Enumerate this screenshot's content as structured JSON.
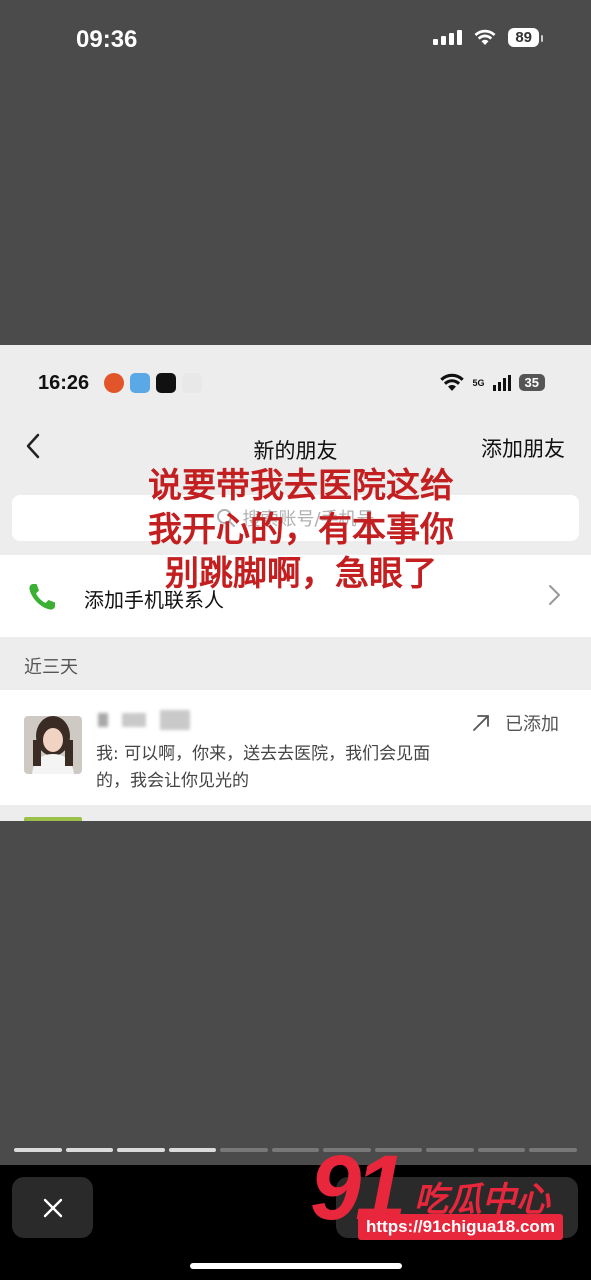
{
  "outer_status": {
    "time": "09:36",
    "battery": "89"
  },
  "inner_status": {
    "time": "16:26",
    "network": "5G",
    "battery": "35"
  },
  "nav": {
    "title": "新的朋友",
    "add_label": "添加朋友"
  },
  "search": {
    "placeholder": "搜索账号/手机号"
  },
  "phone_contacts": {
    "label": "添加手机联系人"
  },
  "section": {
    "title": "近三天"
  },
  "friend": {
    "message": "我: 可以啊，你来，送去去医院，我们会见面的，我会让你见光的",
    "status": "已添加"
  },
  "overlay_caption": "说要带我去医院这给我开心的，有本事你别跳脚啊，急眼了",
  "story_progress": {
    "total": 11,
    "current": 4
  },
  "watermark": {
    "number": "91",
    "name": "吃瓜中心",
    "url": "https://91chigua18.com"
  },
  "colors": {
    "accent_green": "#3cb034",
    "caption_red": "#c41f20",
    "watermark_red": "#e8263c"
  },
  "icons": [
    "signal-icon",
    "wifi-icon",
    "battery-icon",
    "back-icon",
    "search-icon",
    "phone-icon",
    "chevron-right-icon",
    "arrow-up-right-icon",
    "close-icon"
  ]
}
